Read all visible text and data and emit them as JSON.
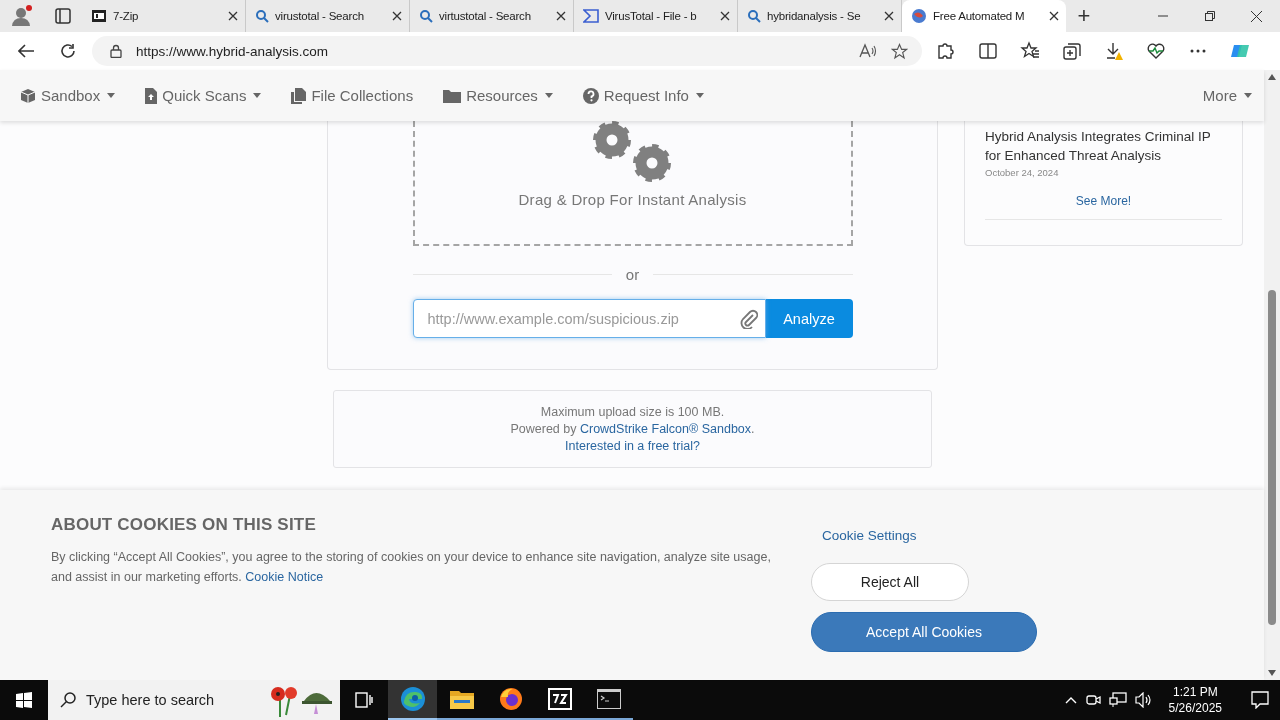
{
  "browser": {
    "tabs": [
      {
        "kind": "archive",
        "label": "7-Zip",
        "selected": false
      },
      {
        "kind": "search",
        "label": "virustotal - Search",
        "selected": false
      },
      {
        "kind": "search",
        "label": "virtustotal - Search",
        "selected": false
      },
      {
        "kind": "sigma",
        "label": "VirusTotal - File - b",
        "selected": false
      },
      {
        "kind": "search",
        "label": "hybridanalysis - Se",
        "selected": false
      },
      {
        "kind": "site",
        "label": "Free Automated M",
        "selected": true
      }
    ],
    "new_tab": "+",
    "url": "https://www.hybrid-analysis.com"
  },
  "nav": {
    "items": [
      {
        "kind": "cube",
        "label": "Sandbox",
        "dropdown": true
      },
      {
        "kind": "file",
        "label": "Quick Scans",
        "dropdown": true
      },
      {
        "kind": "files",
        "label": "File Collections",
        "dropdown": false
      },
      {
        "kind": "folder",
        "label": "Resources",
        "dropdown": true
      },
      {
        "kind": "question",
        "label": "Request Info",
        "dropdown": true
      }
    ],
    "more": {
      "label": "More",
      "dropdown": true
    }
  },
  "upload": {
    "drop_text": "Drag & Drop For Instant Analysis",
    "or": "or",
    "url_placeholder": "http://www.example.com/suspicious.zip",
    "analyze": "Analyze"
  },
  "info": {
    "max_size": "Maximum upload size is 100 MB.",
    "powered_prefix": "Powered by ",
    "powered_link": "CrowdStrike Falcon® Sandbox",
    "powered_suffix": ".",
    "trial_link": "Interested in a free trial?"
  },
  "news": {
    "title": "Hybrid Analysis Integrates Criminal IP for Enhanced Threat Analysis",
    "date": "October 24, 2024",
    "see_more": "See More!"
  },
  "cookies": {
    "heading": "ABOUT COOKIES ON THIS SITE",
    "text": "By clicking “Accept All Cookies”, you agree to the storing of cookies on your device to enhance site navigation, analyze site usage, and assist in our marketing efforts.",
    "notice_link": "Cookie Notice",
    "settings": "Cookie Settings",
    "reject": "Reject All",
    "accept": "Accept All Cookies"
  },
  "taskbar": {
    "search_placeholder": "Type here to search",
    "apps": [
      {
        "kind": "edge",
        "selected": true
      },
      {
        "kind": "explorer",
        "selected": false
      },
      {
        "kind": "firefox",
        "selected": false
      },
      {
        "kind": "archive",
        "selected": false
      },
      {
        "kind": "terminal",
        "selected": false
      }
    ],
    "time": "1:21 PM",
    "date": "5/26/2025"
  }
}
